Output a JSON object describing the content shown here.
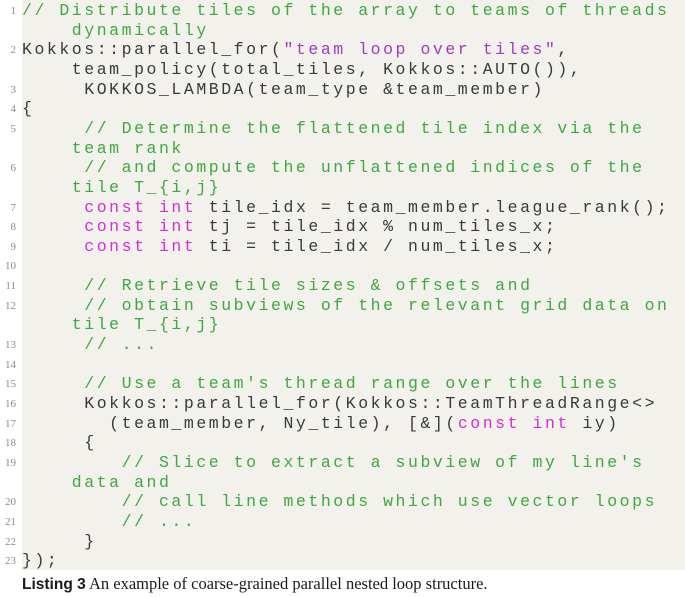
{
  "listing": {
    "rows": [
      {
        "no": "1",
        "segments": [
          {
            "type": "comment",
            "text": "// Distribute tiles of the array to teams of threads"
          }
        ]
      },
      {
        "no": "",
        "segments": [
          {
            "type": "comment",
            "text": "    dynamically"
          }
        ]
      },
      {
        "no": "2",
        "segments": [
          {
            "type": "text",
            "text": "Kokkos::parallel_for("
          },
          {
            "type": "string",
            "text": "\"team loop over tiles\""
          },
          {
            "type": "text",
            "text": ","
          }
        ]
      },
      {
        "no": "",
        "segments": [
          {
            "type": "text",
            "text": "    team_policy(total_tiles, Kokkos::AUTO()),"
          }
        ]
      },
      {
        "no": "3",
        "segments": [
          {
            "type": "text",
            "text": "     KOKKOS_LAMBDA(team_type &team_member)"
          }
        ]
      },
      {
        "no": "4",
        "segments": [
          {
            "type": "text",
            "text": "{"
          }
        ]
      },
      {
        "no": "5",
        "segments": [
          {
            "type": "comment",
            "text": "     // Determine the flattened tile index via the"
          }
        ]
      },
      {
        "no": "",
        "segments": [
          {
            "type": "comment",
            "text": "    team rank"
          }
        ]
      },
      {
        "no": "6",
        "segments": [
          {
            "type": "comment",
            "text": "     // and compute the unflattened indices of the"
          }
        ]
      },
      {
        "no": "",
        "segments": [
          {
            "type": "comment",
            "text": "    tile T_{i,j}"
          }
        ]
      },
      {
        "no": "7",
        "segments": [
          {
            "type": "text",
            "text": "     "
          },
          {
            "type": "keyword",
            "text": "const int"
          },
          {
            "type": "text",
            "text": " tile_idx = team_member.league_rank();"
          }
        ]
      },
      {
        "no": "8",
        "segments": [
          {
            "type": "text",
            "text": "     "
          },
          {
            "type": "keyword",
            "text": "const int"
          },
          {
            "type": "text",
            "text": " tj = tile_idx % num_tiles_x;"
          }
        ]
      },
      {
        "no": "9",
        "segments": [
          {
            "type": "text",
            "text": "     "
          },
          {
            "type": "keyword",
            "text": "const int"
          },
          {
            "type": "text",
            "text": " ti = tile_idx / num_tiles_x;"
          }
        ]
      },
      {
        "no": "10",
        "segments": [
          {
            "type": "text",
            "text": ""
          }
        ]
      },
      {
        "no": "11",
        "segments": [
          {
            "type": "comment",
            "text": "     // Retrieve tile sizes & offsets and"
          }
        ]
      },
      {
        "no": "12",
        "segments": [
          {
            "type": "comment",
            "text": "     // obtain subviews of the relevant grid data on"
          }
        ]
      },
      {
        "no": "",
        "segments": [
          {
            "type": "comment",
            "text": "    tile T_{i,j}"
          }
        ]
      },
      {
        "no": "13",
        "segments": [
          {
            "type": "comment",
            "text": "     // ..."
          }
        ]
      },
      {
        "no": "14",
        "segments": [
          {
            "type": "text",
            "text": ""
          }
        ]
      },
      {
        "no": "15",
        "segments": [
          {
            "type": "comment",
            "text": "     // Use a team's thread range over the lines"
          }
        ]
      },
      {
        "no": "16",
        "segments": [
          {
            "type": "text",
            "text": "     Kokkos::parallel_for(Kokkos::TeamThreadRange<>"
          }
        ]
      },
      {
        "no": "17",
        "segments": [
          {
            "type": "text",
            "text": "       (team_member, Ny_tile), [&]("
          },
          {
            "type": "keyword",
            "text": "const int"
          },
          {
            "type": "text",
            "text": " iy)"
          }
        ]
      },
      {
        "no": "18",
        "segments": [
          {
            "type": "text",
            "text": "     {"
          }
        ]
      },
      {
        "no": "19",
        "segments": [
          {
            "type": "comment",
            "text": "        // Slice to extract a subview of my line's"
          }
        ]
      },
      {
        "no": "",
        "segments": [
          {
            "type": "comment",
            "text": "    data and"
          }
        ]
      },
      {
        "no": "20",
        "segments": [
          {
            "type": "comment",
            "text": "        // call line methods which use vector loops"
          }
        ]
      },
      {
        "no": "21",
        "segments": [
          {
            "type": "comment",
            "text": "        // ..."
          }
        ]
      },
      {
        "no": "22",
        "segments": [
          {
            "type": "text",
            "text": "     }"
          }
        ]
      },
      {
        "no": "23",
        "segments": [
          {
            "type": "text",
            "text": "});"
          }
        ]
      }
    ]
  },
  "caption": {
    "label": "Listing 3",
    "text": " An example of coarse-grained parallel nested loop structure."
  },
  "colors": {
    "background": "#f2f1ec",
    "comment": "#3fa83f",
    "string": "#a23bc4",
    "keyword": "#d62ed6",
    "text": "#3a3a3a"
  }
}
